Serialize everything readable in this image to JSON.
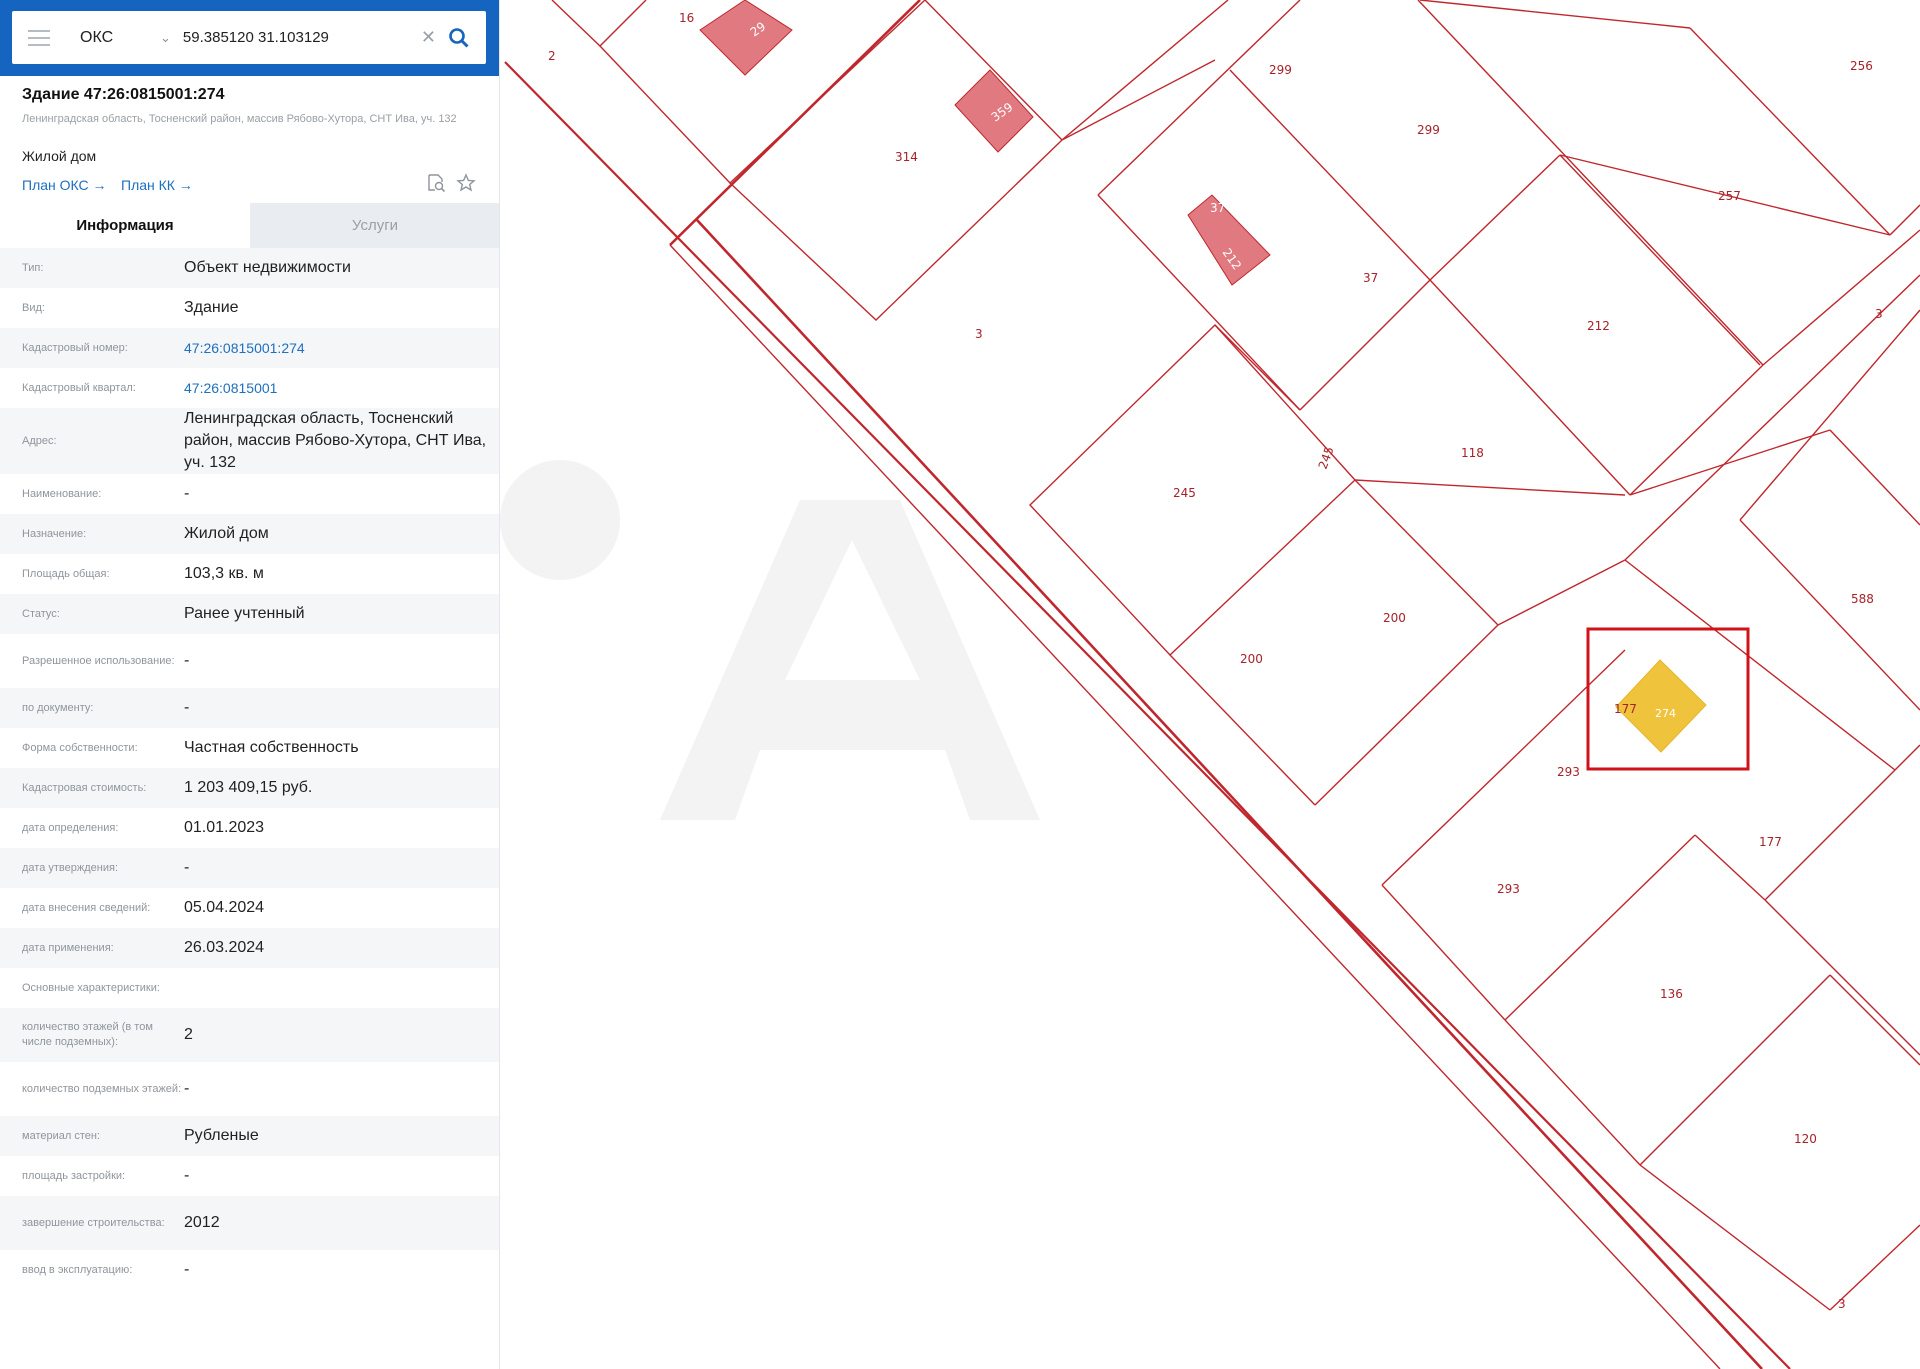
{
  "search": {
    "mode": "ОКС",
    "query": "59.385120 31.103129"
  },
  "object": {
    "title": "Здание 47:26:0815001:274",
    "address": "Ленинградская область, Тосненский район, массив Рябово-Хутора, СНТ Ива, уч. 132",
    "kind": "Жилой дом",
    "links": {
      "plan_oks": "План ОКС →",
      "plan_kk": "План КК →"
    }
  },
  "tabs": {
    "info": "Информация",
    "services": "Услуги"
  },
  "properties": [
    {
      "label": "Тип:",
      "value": "Объект недвижимости"
    },
    {
      "label": "Вид:",
      "value": "Здание"
    },
    {
      "label": "Кадастровый номер:",
      "value": "47:26:0815001:274",
      "link": true
    },
    {
      "label": "Кадастровый квартал:",
      "value": "47:26:0815001",
      "link": true
    },
    {
      "label": "Адрес:",
      "value": "Ленинградская область, Тосненский район, массив Рябово-Хутора, СНТ Ива, уч. 132"
    },
    {
      "label": "Наименование:",
      "value": "-"
    },
    {
      "label": "Назначение:",
      "value": "Жилой дом"
    },
    {
      "label": "Площадь общая:",
      "value": "103,3 кв. м"
    },
    {
      "label": "Статус:",
      "value": "Ранее учтенный"
    },
    {
      "label": "Разрешенное использование:",
      "value": "-"
    },
    {
      "label": "по документу:",
      "value": "-"
    },
    {
      "label": "Форма собственности:",
      "value": "Частная собственность"
    },
    {
      "label": "Кадастровая стоимость:",
      "value": "1 203 409,15 руб."
    },
    {
      "label": "дата определения:",
      "value": "01.01.2023"
    },
    {
      "label": "дата утверждения:",
      "value": "-"
    },
    {
      "label": "дата внесения сведений:",
      "value": "05.04.2024"
    },
    {
      "label": "дата применения:",
      "value": "26.03.2024"
    },
    {
      "label": "Основные характеристики:",
      "value": ""
    },
    {
      "label": "количество этажей (в том числе подземных):",
      "value": "2"
    },
    {
      "label": "количество подземных этажей:",
      "value": "-"
    },
    {
      "label": "материал стен:",
      "value": "Рубленые"
    },
    {
      "label": "площадь застройки:",
      "value": "-"
    },
    {
      "label": "завершение строительства:",
      "value": "2012"
    },
    {
      "label": "ввод в эксплуатацию:",
      "value": "-"
    }
  ],
  "map": {
    "colors": {
      "parcel_line": "#c0272d",
      "building_fill": "#e07a80",
      "selected_fill": "#f0c33c",
      "highlight": "#d0121b"
    },
    "parcel_labels": [
      "2",
      "16",
      "299",
      "299",
      "256",
      "314",
      "257",
      "37",
      "3",
      "212",
      "3",
      "118",
      "245",
      "245",
      "200",
      "588",
      "200",
      "177",
      "293",
      "177",
      "293",
      "136",
      "120",
      "3"
    ],
    "buildings": [
      "29",
      "359",
      "37",
      "212"
    ],
    "selected_building": "274",
    "selected_parcel": "177"
  }
}
